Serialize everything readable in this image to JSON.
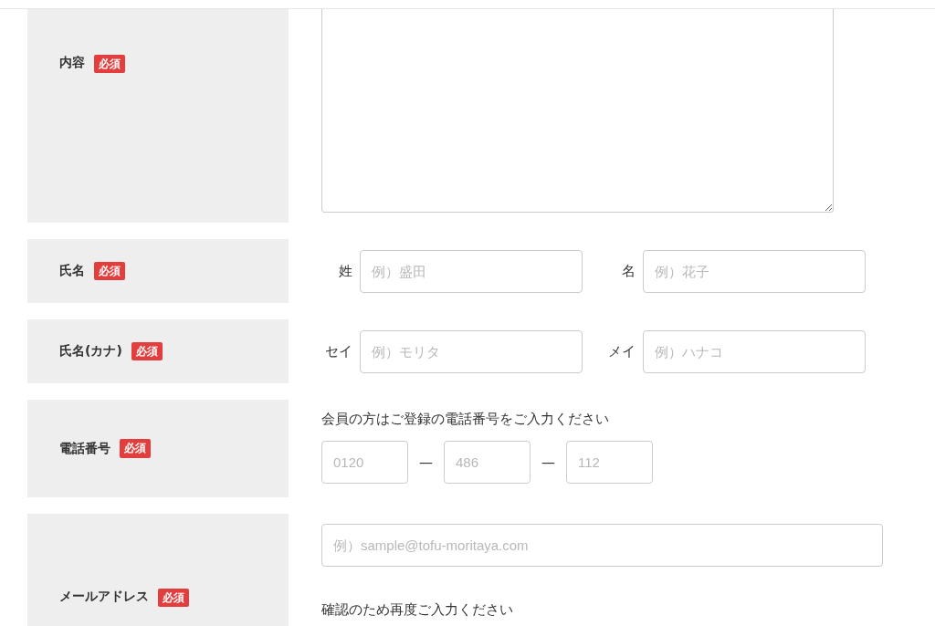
{
  "form_rows": [
    {
      "label": "内容",
      "badge": "必須",
      "kind": "textarea"
    },
    {
      "label": "氏名",
      "badge": "必須",
      "kind": "pair",
      "inputs": [
        {
          "prefix": "姓",
          "placeholder": "例）盛田"
        },
        {
          "prefix": "名",
          "placeholder": "例）花子"
        }
      ]
    },
    {
      "label": "氏名(カナ)",
      "badge": "必須",
      "kind": "pair",
      "inputs": [
        {
          "prefix": "セイ",
          "placeholder": "例）モリタ"
        },
        {
          "prefix": "メイ",
          "placeholder": "例）ハナコ"
        }
      ]
    },
    {
      "label": "電話番号",
      "badge": "必須",
      "kind": "phone",
      "note": "会員の方はご登録の電話番号をご入力ください",
      "inputs": [
        {
          "placeholder": "0120"
        },
        {
          "separator": "—",
          "placeholder": "486"
        },
        {
          "separator": "—",
          "placeholder": "112"
        }
      ]
    },
    {
      "label": "メールアドレス",
      "badge": "必須",
      "kind": "email",
      "placeholder": "例）sample@tofu-moritaya.com",
      "note": "確認のため再度ご入力ください"
    }
  ]
}
